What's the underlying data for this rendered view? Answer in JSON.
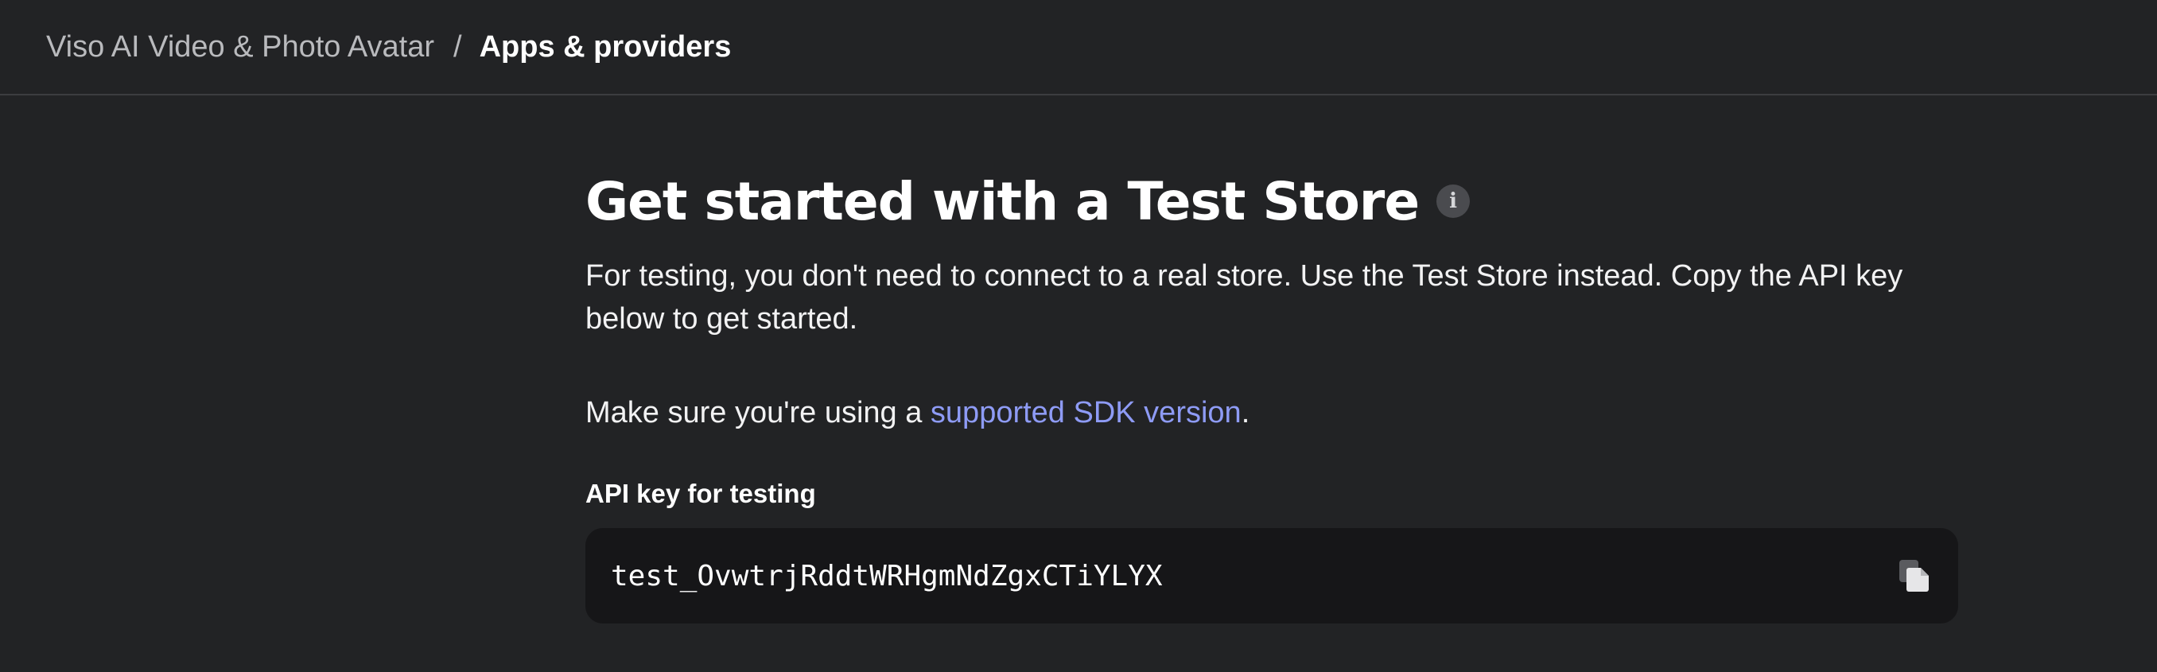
{
  "breadcrumb": {
    "parent": "Viso AI Video & Photo Avatar",
    "separator": "/",
    "current": "Apps & providers"
  },
  "main": {
    "title": "Get started with a Test Store",
    "description": "For testing, you don't need to connect to a real store. Use the Test Store instead. Copy the API key below to get started.",
    "sdk_prefix": "Make sure you're using a ",
    "sdk_link": "supported SDK version",
    "sdk_suffix": ".",
    "api_label": "API key for testing",
    "api_key": "test_OvwtrjRddtWRHgmNdZgxCTiYLYX"
  },
  "icons": {
    "info": "info-icon",
    "copy": "copy-icon"
  },
  "colors": {
    "background": "#222325",
    "link": "#8e9bf5",
    "key_box": "#161618"
  }
}
